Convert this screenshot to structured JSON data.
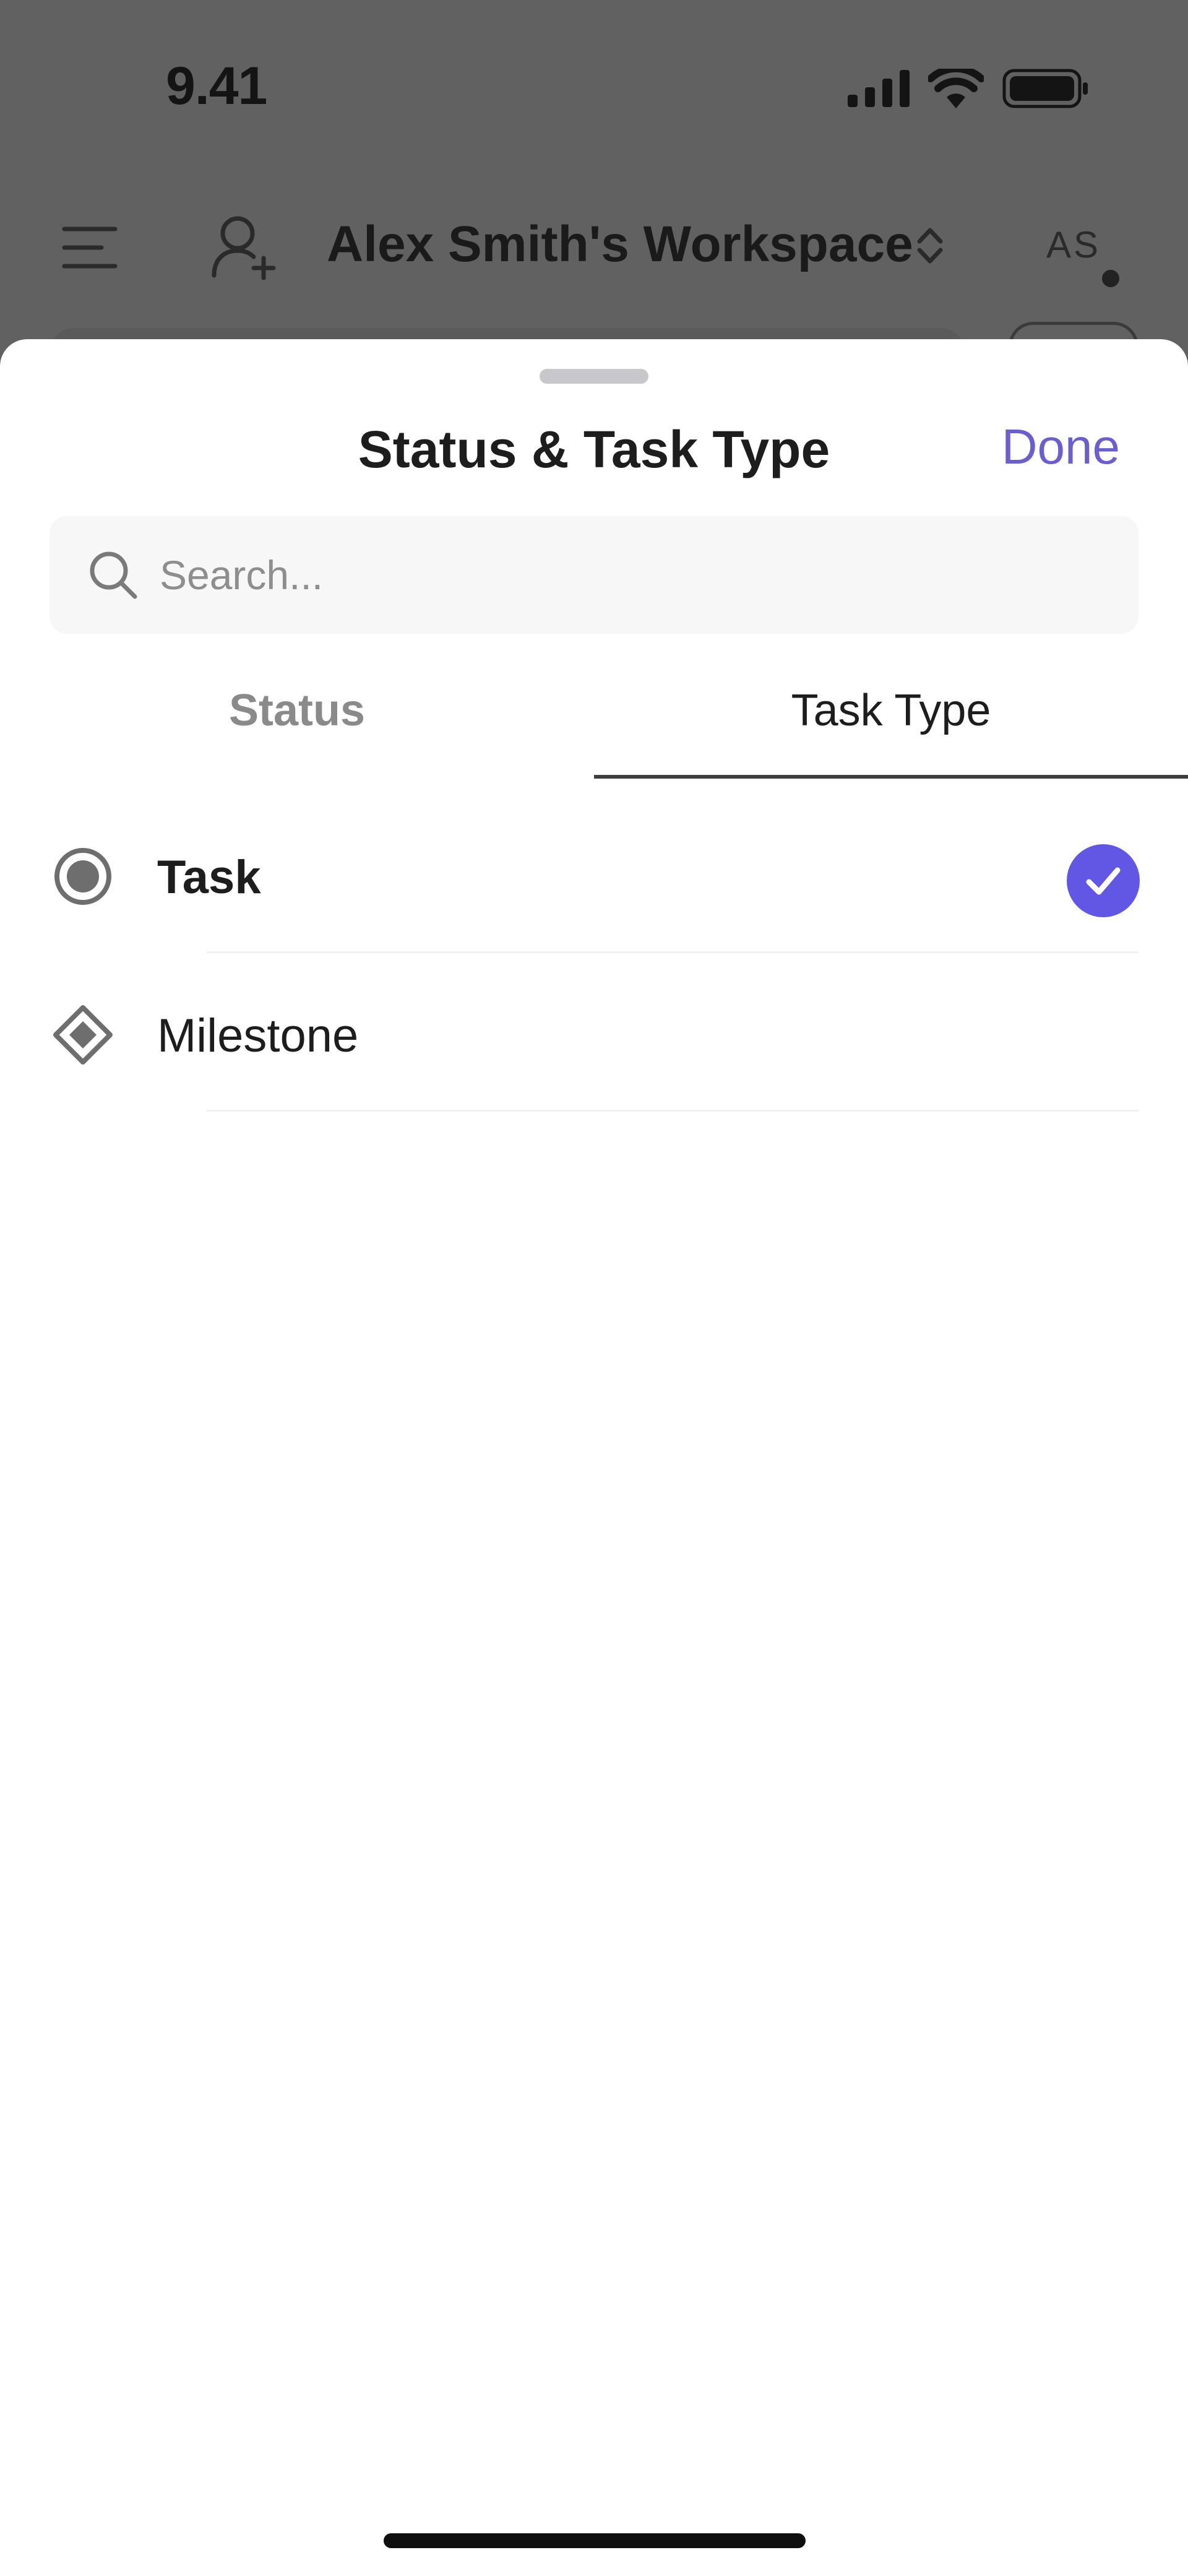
{
  "status_bar": {
    "time": "9.41",
    "icons": [
      "signal-icon",
      "wifi-icon",
      "battery-icon"
    ]
  },
  "header": {
    "menu_icon": "hamburger-menu-icon",
    "invite_icon": "add-person-icon",
    "workspace_title": "Alex Smith's Workspace",
    "workspace_switch_icon": "chevron-up-down-icon",
    "avatar_initials": "AS"
  },
  "sheet": {
    "title": "Status & Task Type",
    "done_label": "Done",
    "search": {
      "placeholder": "Search...",
      "value": ""
    },
    "tabs": [
      {
        "label": "Status",
        "active": false
      },
      {
        "label": "Task Type",
        "active": true
      }
    ],
    "options": [
      {
        "label": "Task",
        "icon": "radio-circle-icon",
        "selected": true
      },
      {
        "label": "Milestone",
        "icon": "diamond-icon",
        "selected": false
      }
    ]
  },
  "colors": {
    "accent": "#6b5fce",
    "check_fill": "#6257e5",
    "overlay": "#616161",
    "sheet_background": "#ffffff",
    "search_background": "#f7f7f8"
  }
}
